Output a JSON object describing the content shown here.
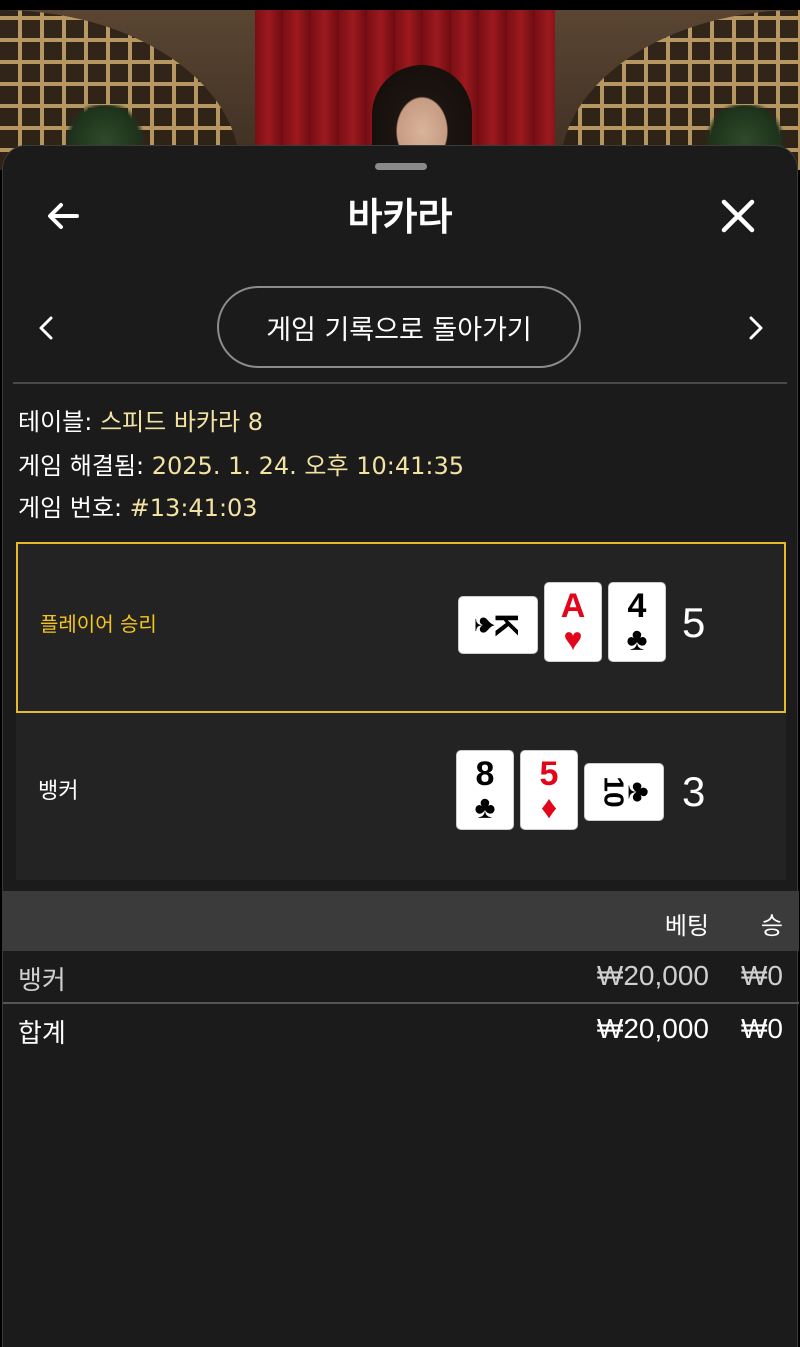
{
  "header": {
    "title": "바카라"
  },
  "nav": {
    "history_label": "게임 기록으로 돌아가기"
  },
  "info": {
    "table_label": "테이블: ",
    "table_value": "스피드 바카라 8",
    "resolved_label": "게임 해결됨: ",
    "resolved_value": "2025. 1. 24. 오후 10:41:35",
    "game_no_label": "게임 번호: ",
    "game_no_value": "#13:41:03"
  },
  "player": {
    "label": "플레이어 승리",
    "score": "5",
    "cards": [
      {
        "rank": "K",
        "suit": "♠",
        "color": "black",
        "orientation": "sideways"
      },
      {
        "rank": "A",
        "suit": "♥",
        "color": "red",
        "orientation": "upright"
      },
      {
        "rank": "4",
        "suit": "♣",
        "color": "black",
        "orientation": "upright"
      }
    ]
  },
  "banker": {
    "label": "뱅커",
    "score": "3",
    "cards": [
      {
        "rank": "8",
        "suit": "♣",
        "color": "black",
        "orientation": "upright"
      },
      {
        "rank": "5",
        "suit": "♦",
        "color": "red",
        "orientation": "upright"
      },
      {
        "rank": "10",
        "suit": "♣",
        "color": "black",
        "orientation": "sideways"
      }
    ]
  },
  "bets": {
    "headers": {
      "bet": "베팅",
      "win": "승"
    },
    "rows": [
      {
        "name": "뱅커",
        "bet": "₩20,000",
        "win": "₩0"
      }
    ],
    "total": {
      "name": "합계",
      "bet": "₩20,000",
      "win": "₩0"
    }
  },
  "colors": {
    "highlight_border": "#e4b92c",
    "player_label": "#f5c518",
    "info_value": "#f3e3a2",
    "card_red": "#e3061a"
  }
}
